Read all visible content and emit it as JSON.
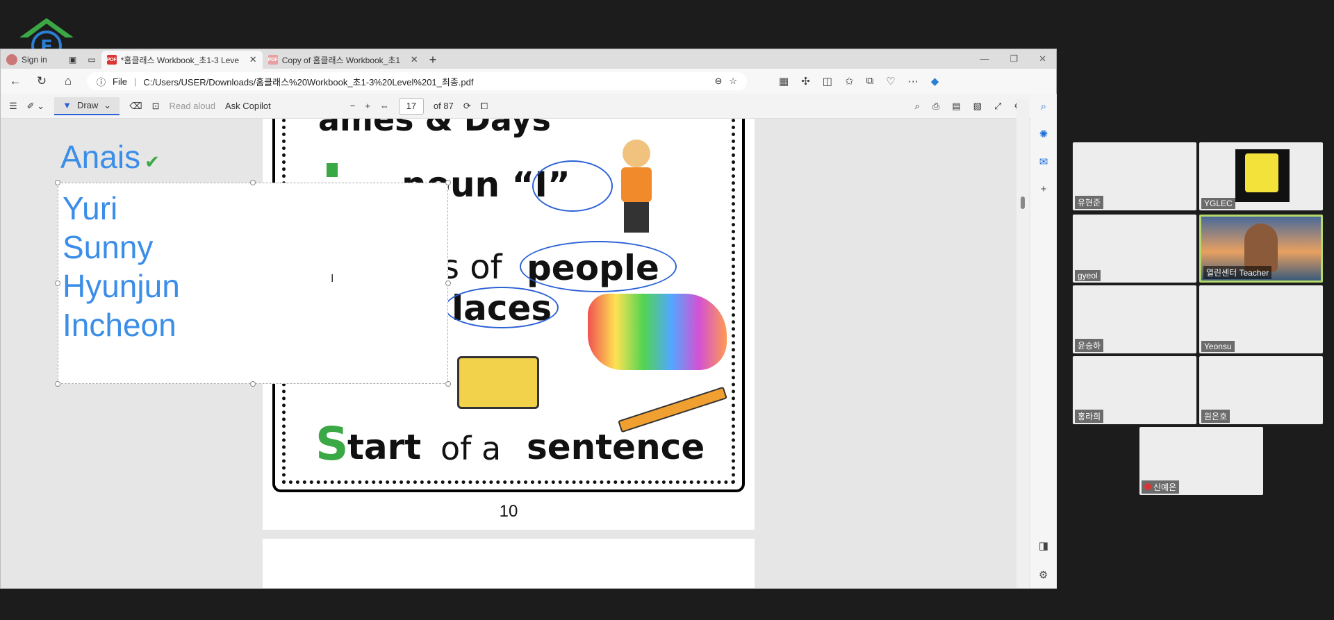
{
  "browser": {
    "tabs": [
      {
        "label": "*홈클래스 Workbook_초1-3 Leve",
        "active": true
      },
      {
        "label": "Copy of 홈클래스 Workbook_초1",
        "active": false
      }
    ],
    "sign_in": "Sign in",
    "url_prefix": "File",
    "url": "C:/Users/USER/Downloads/홈클래스%20Workbook_초1-3%20Level%201_최종.pdf"
  },
  "pdf_toolbar": {
    "draw_label": "Draw",
    "read_aloud": "Read aloud",
    "ask_copilot": "Ask Copilot",
    "page_current": "17",
    "page_total": "of 87"
  },
  "page": {
    "headline_top": "ames & Days",
    "pronoun": "noun “I”",
    "people_prefix": "s of",
    "people": "people",
    "places": "laces",
    "start_letter": "S",
    "start_word1": "tart",
    "start_word2": "of a",
    "start_word3": "sentence",
    "page_number": "10"
  },
  "annotation": {
    "first_name": "Anais",
    "names": [
      "Yuri",
      "Sunny",
      "Hyunjun",
      "Incheon"
    ]
  },
  "participants": [
    {
      "name": "유현준"
    },
    {
      "name": "YGLEC"
    },
    {
      "name": "gyeol"
    },
    {
      "name": "열린센터 Teacher"
    },
    {
      "name": "윤승하"
    },
    {
      "name": "Yeonsu"
    },
    {
      "name": "홍라희"
    },
    {
      "name": "원은호"
    },
    {
      "name": "신예은"
    }
  ]
}
